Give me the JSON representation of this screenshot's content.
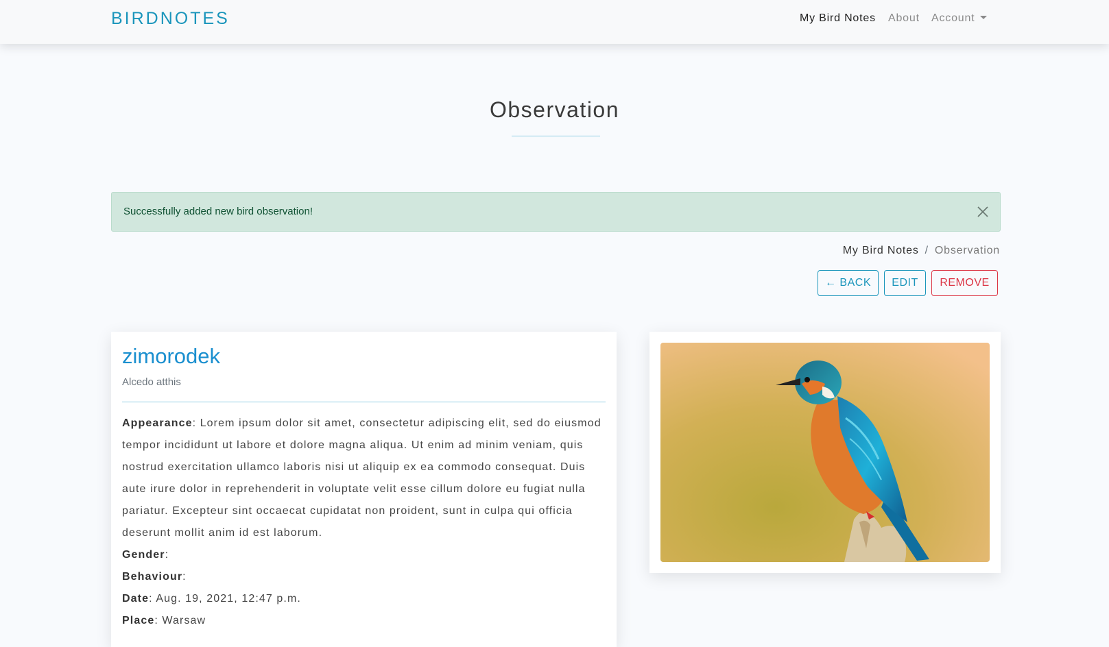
{
  "navbar": {
    "brand": "BIRDNOTES",
    "links": [
      "My Bird Notes",
      "About",
      "Account"
    ]
  },
  "page": {
    "title": "Observation"
  },
  "alert": {
    "message": "Successfully added new bird observation!"
  },
  "breadcrumb": {
    "parent": "My Bird Notes",
    "separator": "/",
    "current": "Observation"
  },
  "actions": {
    "back": "← BACK",
    "edit": "EDIT",
    "remove": "REMOVE"
  },
  "observation": {
    "name": "zimorodek",
    "latin_name": "Alcedo atthis",
    "fields": [
      {
        "label": "Appearance",
        "value": "Lorem ipsum dolor sit amet, consectetur adipiscing elit, sed do eiusmod tempor incididunt ut labore et dolore magna aliqua. Ut enim ad minim veniam, quis nostrud exercitation ullamco laboris nisi ut aliquip ex ea commodo consequat. Duis aute irure dolor in reprehenderit in voluptate velit esse cillum dolore eu fugiat nulla pariatur. Excepteur sint occaecat cupidatat non proident, sunt in culpa qui officia deserunt mollit anim id est laborum."
      },
      {
        "label": "Gender",
        "value": ""
      },
      {
        "label": "Behaviour",
        "value": ""
      },
      {
        "label": "Date",
        "value": "Aug. 19, 2021, 12:47 p.m."
      },
      {
        "label": "Place",
        "value": "Warsaw"
      }
    ]
  },
  "colors": {
    "brand": "#1a95bb",
    "bird_name": "#1a8fcf",
    "alert_bg": "#d1e7dd",
    "danger": "#dc3545"
  },
  "icons": {
    "close": "close-icon",
    "bird_photo": "kingfisher-photo"
  }
}
